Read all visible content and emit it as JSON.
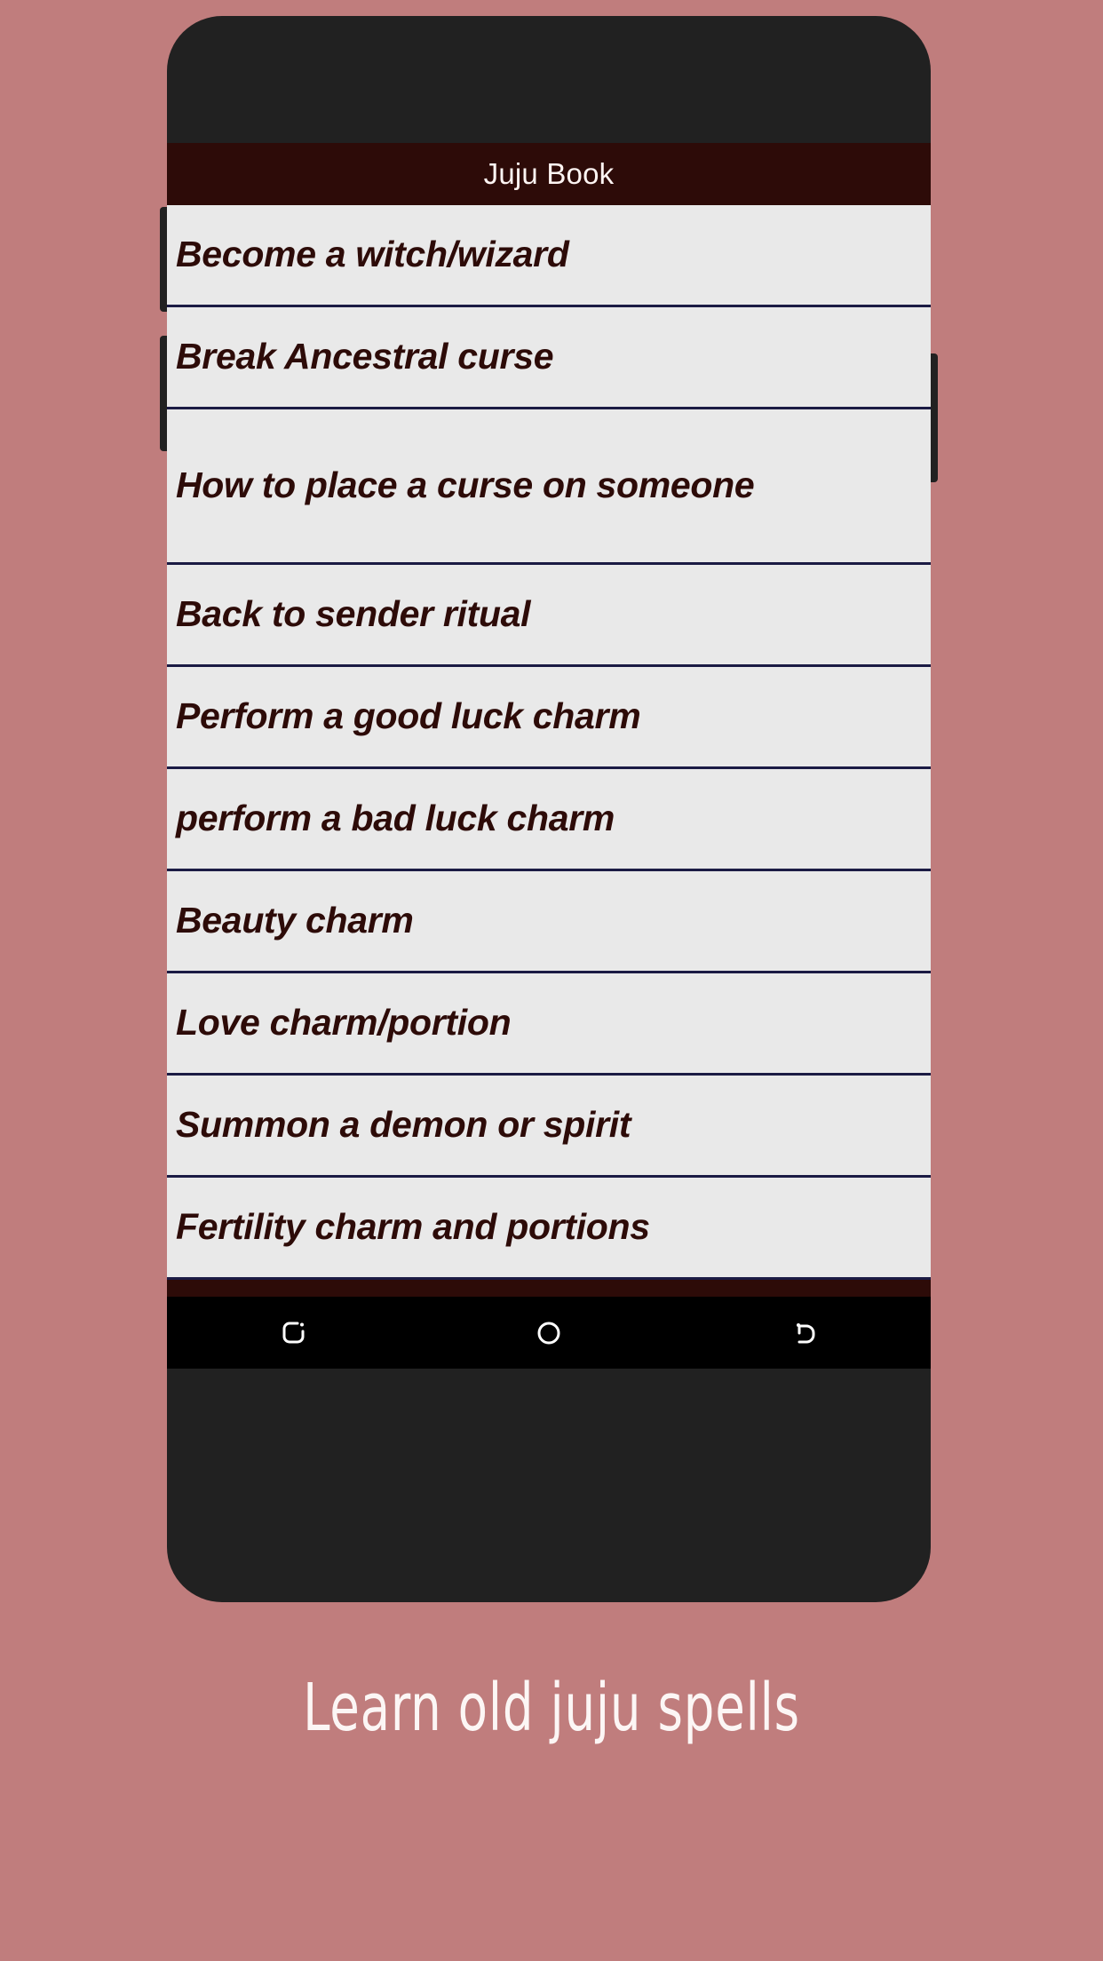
{
  "theme": {
    "background_color": "#c07d7d",
    "phone_frame_color": "#212121",
    "title_bar_color": "#2d0b08",
    "list_background_color": "#e9e9e9",
    "list_text_color": "#2d0b08",
    "divider_color": "#1b1b44",
    "nav_bar_color": "#000000",
    "caption_color": "#fcf6f5"
  },
  "app": {
    "title": "Juju Book"
  },
  "spell_list": [
    {
      "label": "Become a witch/wizard",
      "lines": 1
    },
    {
      "label": "Break Ancestral curse",
      "lines": 1
    },
    {
      "label": "How to place a curse on someone",
      "lines": 2
    },
    {
      "label": "Back to sender ritual",
      "lines": 1
    },
    {
      "label": "Perform a good luck charm",
      "lines": 1
    },
    {
      "label": "perform a bad luck charm",
      "lines": 1
    },
    {
      "label": "Beauty charm",
      "lines": 1
    },
    {
      "label": "Love charm/portion",
      "lines": 1
    },
    {
      "label": "Summon a demon or spirit",
      "lines": 1
    },
    {
      "label": "Fertility charm and portions",
      "lines": 1
    }
  ],
  "nav_bar": {
    "buttons": [
      {
        "icon": "recent-apps-icon",
        "label": "Recent apps"
      },
      {
        "icon": "home-icon",
        "label": "Home"
      },
      {
        "icon": "back-icon",
        "label": "Back"
      }
    ]
  },
  "caption": {
    "text": "Learn old juju spells"
  },
  "hardware": {
    "volume_up": "Volume up",
    "volume_down": "Volume down",
    "power": "Power"
  }
}
